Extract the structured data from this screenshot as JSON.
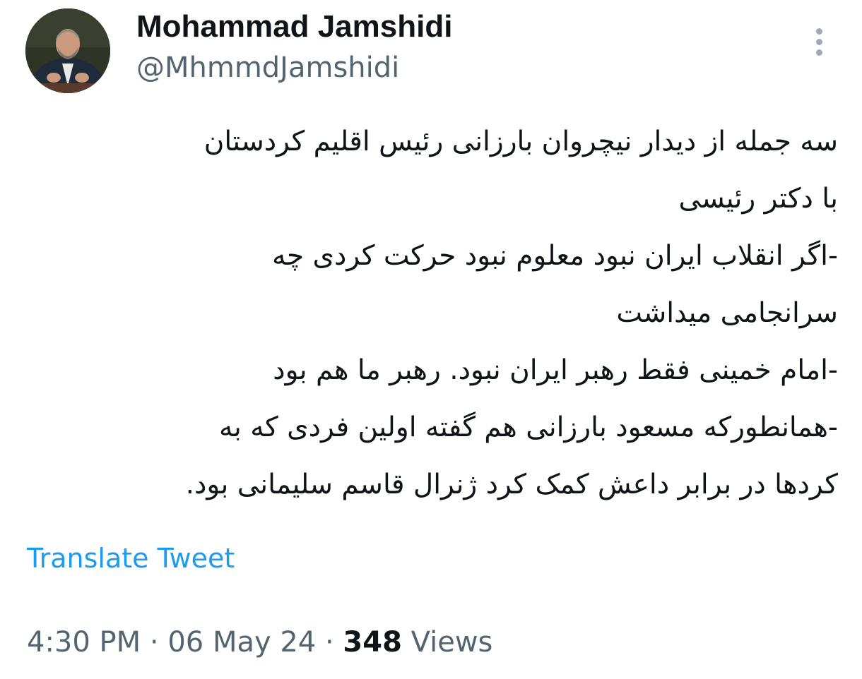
{
  "author": {
    "display_name": "Mohammad Jamshidi",
    "handle": "@MhmmdJamshidi",
    "avatar": "profile-photo"
  },
  "menu_icon": "more-vertical-icon",
  "tweet": {
    "lines": [
      "سه جمله از دیدار نیچروان بارزانی رئیس اقلیم کردستان",
      "با دکتر رئیسی",
      "-اگر انقلاب ایران نبود معلوم نبود حرکت کردی چه",
      "سرانجامی میداشت",
      "-امام خمینی فقط رهبر ایران نبود. رهبر ما هم بود",
      "-همانطورکه مسعود بارزانی هم گفته اولین فردی که به",
      "کردها در برابر داعش کمک کرد ژنرال قاسم سلیمانی بود."
    ]
  },
  "translate_label": "Translate Tweet",
  "meta": {
    "time": "4:30 PM",
    "date": "06 May 24",
    "separator": " · ",
    "views_count": "348",
    "views_label": "Views"
  },
  "colors": {
    "text": "#0f1419",
    "secondary": "#536471",
    "link": "#1d9bf0"
  }
}
